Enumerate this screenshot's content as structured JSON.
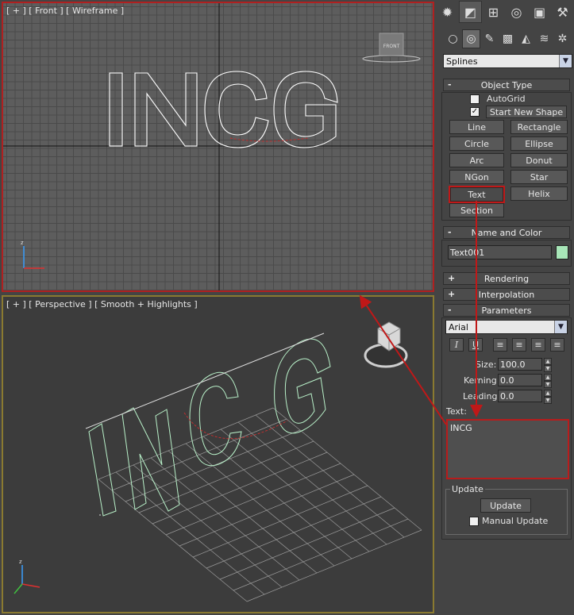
{
  "viewports": {
    "front": {
      "label": "[ + ] [ Front ] [ Wireframe ]",
      "text": "INCG",
      "cube_label": "FRONT"
    },
    "perspective": {
      "label": "[ + ] [ Perspective ] [ Smooth + Highlights ]",
      "text": "INCG"
    }
  },
  "panel": {
    "tabs": [
      "create-tab",
      "modify-tab",
      "hierarchy-tab",
      "motion-tab",
      "display-tab",
      "utilities-tab"
    ],
    "categories": [
      "geometry",
      "shapes",
      "lights",
      "cameras",
      "helpers",
      "space-warps",
      "systems"
    ],
    "category_dropdown": "Splines",
    "object_type": {
      "title": "Object Type",
      "autogrid_label": "AutoGrid",
      "start_new_shape_label": "Start New Shape",
      "start_new_shape_checked": true,
      "buttons": [
        "Line",
        "Rectangle",
        "Circle",
        "Ellipse",
        "Arc",
        "Donut",
        "NGon",
        "Star",
        "Text",
        "Helix",
        "Section"
      ],
      "active_button": "Text"
    },
    "name_and_color": {
      "title": "Name and Color",
      "name": "Text001",
      "color": "#a8e6b8"
    },
    "rendering": {
      "title": "Rendering"
    },
    "interpolation": {
      "title": "Interpolation"
    },
    "parameters": {
      "title": "Parameters",
      "font": "Arial",
      "size_label": "Size:",
      "size": "100.0",
      "kerning_label": "Kerning:",
      "kerning": "0.0",
      "leading_label": "Leading:",
      "leading": "0.0",
      "text_label": "Text:",
      "text_value": "INCG"
    },
    "update": {
      "group_label": "Update",
      "button": "Update",
      "manual_label": "Manual Update"
    }
  },
  "colors": {
    "highlight": "#c01818",
    "viewport_active": "#b02020",
    "viewport_inactive": "#8a7a30",
    "spline_front": "#ffffff",
    "spline_persp": "#b8f0c8"
  }
}
